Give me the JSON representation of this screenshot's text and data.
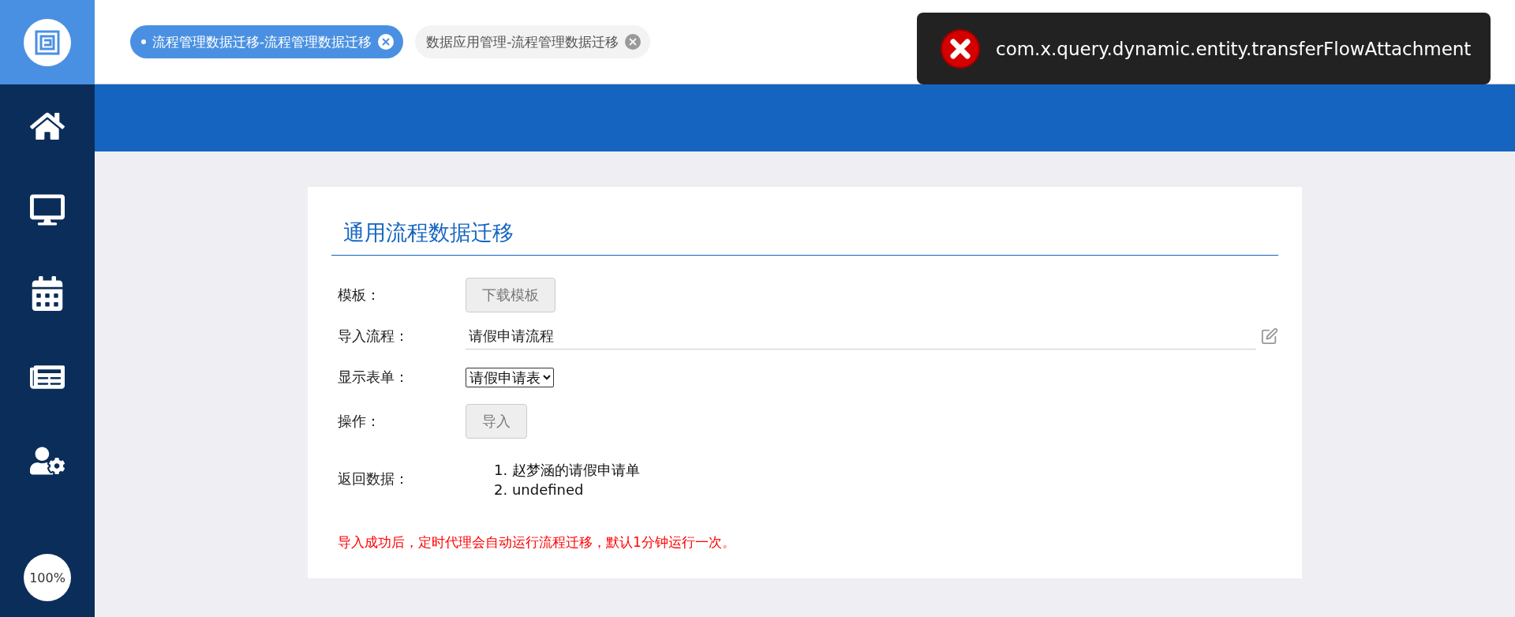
{
  "tabs": [
    {
      "label": "流程管理数据迁移-流程管理数据迁移",
      "selected": true
    },
    {
      "label": "数据应用管理-流程管理数据迁移",
      "selected": false
    }
  ],
  "zoom": "100%",
  "page": {
    "title": "通用流程数据迁移",
    "rows": [
      {
        "kind": "button",
        "label": "模板：",
        "button": "下载模板"
      },
      {
        "kind": "input",
        "label": "导入流程：",
        "value": "请假申请流程"
      },
      {
        "kind": "select",
        "label": "显示表单：",
        "value": "请假申请表"
      },
      {
        "kind": "button",
        "label": "操作：",
        "button": "导入"
      },
      {
        "kind": "list",
        "label": "返回数据：",
        "items": [
          "1. 赵梦涵的请假申请单",
          "2. undefined"
        ]
      }
    ],
    "note": "导入成功后，定时代理会自动运行流程迁移，默认1分钟运行一次。"
  },
  "toast": {
    "message": "com.x.query.dynamic.entity.transferFlowAttachment"
  }
}
